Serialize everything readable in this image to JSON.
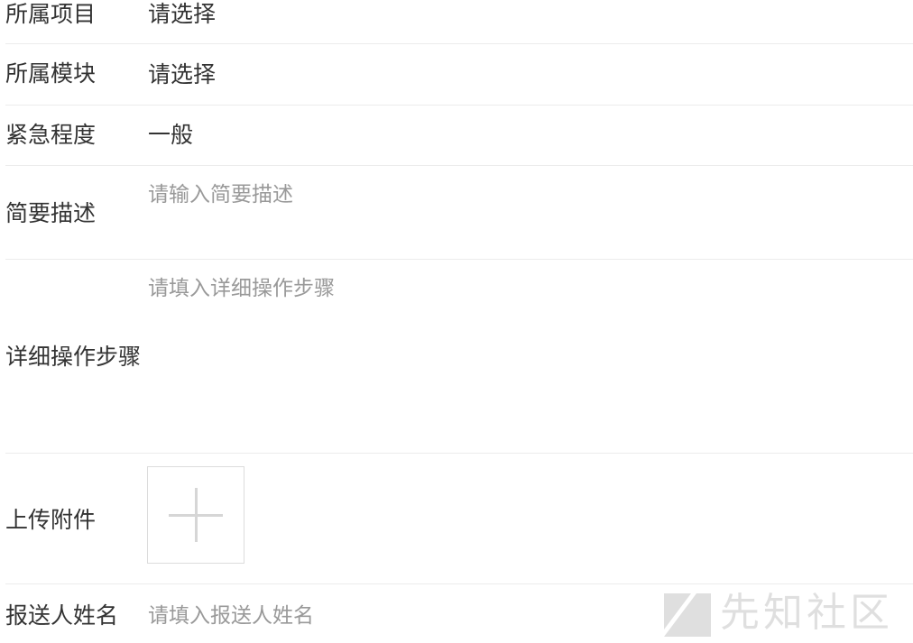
{
  "form": {
    "project": {
      "label": "所属项目",
      "value": "请选择"
    },
    "module": {
      "label": "所属模块",
      "value": "请选择"
    },
    "urgency": {
      "label": "紧急程度",
      "value": "一般"
    },
    "summary": {
      "label": "简要描述",
      "placeholder": "请输入简要描述"
    },
    "steps": {
      "label": "详细操作步骤",
      "placeholder": "请填入详细操作步骤"
    },
    "attachment": {
      "label": "上传附件",
      "add_icon": "plus-icon"
    },
    "reporter": {
      "label": "报送人姓名",
      "placeholder": "请填入报送人姓名"
    }
  },
  "watermark": {
    "text": "先知社区",
    "icon": "xianzhi-logo"
  }
}
